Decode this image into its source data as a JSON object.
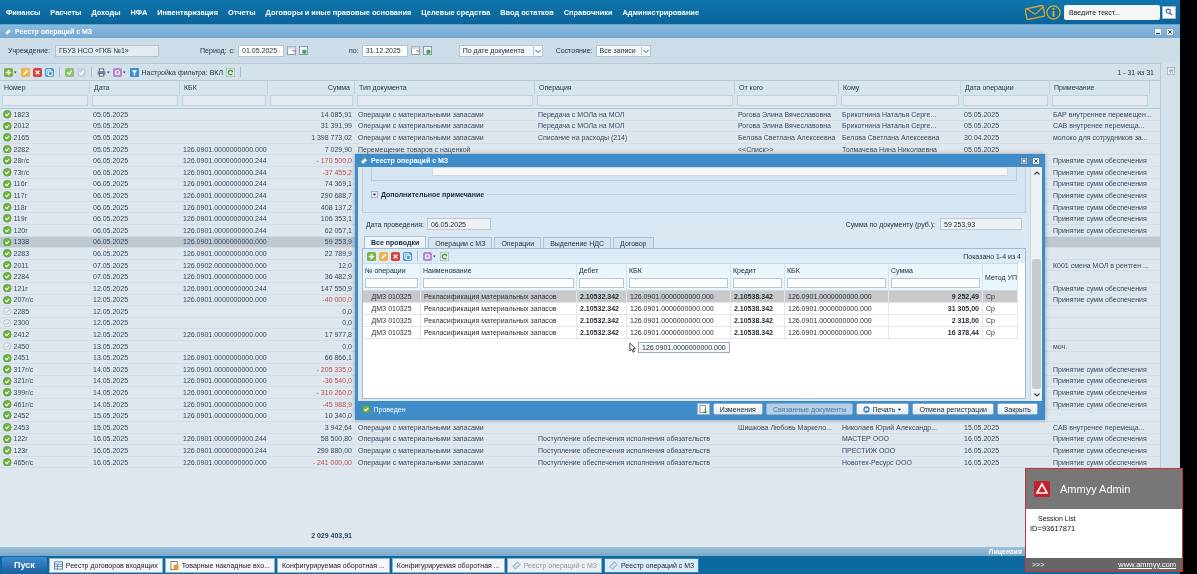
{
  "menu": [
    "Финансы",
    "Расчеты",
    "Доходы",
    "НФА",
    "Инвентаризация",
    "Отчеты",
    "Договоры и иные правовые основания",
    "Целевые средства",
    "Ввод остатков",
    "Справочники",
    "Администрирование"
  ],
  "search": {
    "placeholder": "Введите текст..."
  },
  "window": {
    "title": "Реестр операций с МЗ"
  },
  "filters": {
    "institution_label": "Учреждение:",
    "institution": "ГБУЗ НСО «ГКБ №1»",
    "period_label": "Период:",
    "from_label": "с:",
    "from": "01.05.2025",
    "to_label": "по:",
    "to": "31.12.2025",
    "date_mode": "По дате документа",
    "state_label": "Состояние:",
    "state": "Все записи"
  },
  "toolbar": {
    "filter_setting": "Настройка фильтра: ВКЛ",
    "paging": "1 - 31 из 31"
  },
  "columns": [
    "Номер",
    "Дата",
    "КБК",
    "Сумма",
    "Тип документа",
    "Операция",
    "От кого",
    "Кому",
    "Дата операции",
    "Примечание"
  ],
  "rows": [
    {
      "number": "1823",
      "date": "05.05.2025",
      "sum": "14 085,91",
      "doc_type": "Операции с материальными запасами",
      "operation": "Передача с МОЛа на МОЛ",
      "from": "Рогова Элина Вячеславовна",
      "to": "Брикотнина Наталья Серге...",
      "op_date": "05.05.2025",
      "note": "БАР внутреннее перемещен...",
      "posted": true,
      "negative": false,
      "selected": false
    },
    {
      "number": "2012",
      "date": "05.05.2025",
      "sum": "31 391,99",
      "doc_type": "Операции с материальными запасами",
      "operation": "Передача с МОЛа на МОЛ",
      "from": "Рогова Элина Вячеславовна",
      "to": "Брикотнина Наталья Серге...",
      "op_date": "05.05.2025",
      "note": "САВ внутренее перемеща...",
      "posted": true,
      "negative": false,
      "selected": false
    },
    {
      "number": "2165",
      "date": "05.05.2025",
      "sum": "1 398 773,02",
      "doc_type": "Операции с материальными запасами",
      "operation": "Списание на расходы (214)",
      "from": "Белова Светлана Алексеевна",
      "to": "Белова Светлана Алексеевна",
      "op_date": "30.04.2025",
      "note": "молоко для сотрудников за...",
      "posted": true,
      "negative": false,
      "selected": false
    },
    {
      "number": "2282",
      "date": "05.05.2025",
      "kbk": "126.0901.0000000000.000",
      "sum": "7 029,90",
      "doc_type": "Перемещение товаров с наценкой",
      "from": "<<Списк>>",
      "to": "Толмачева Нина Николаевна",
      "op_date": "05.05.2025",
      "posted": true,
      "negative": false,
      "selected": false
    },
    {
      "number": "28г/с",
      "date": "06.05.2025",
      "kbk": "126.0901.0000000000.244",
      "sum": "- 170 500,0",
      "note": "Принятие сумм обеспечения",
      "posted": true,
      "negative": true,
      "selected": false
    },
    {
      "number": "73г/с",
      "date": "06.05.2025",
      "kbk": "126.0901.0000000000.244",
      "sum": "-37 455,2",
      "note": "Принятие сумм обеспечения",
      "posted": true,
      "negative": true,
      "selected": false
    },
    {
      "number": "116г",
      "date": "06.05.2025",
      "kbk": "126.0901.0000000000.244",
      "sum": "74 369,1",
      "note": "Принятие сумм обеспечения",
      "posted": true,
      "negative": false,
      "selected": false
    },
    {
      "number": "117г",
      "date": "06.05.2025",
      "kbk": "126.0901.0000000000.244",
      "sum": "290 688,7",
      "note": "Принятие сумм обеспечения",
      "posted": true,
      "negative": false,
      "selected": false
    },
    {
      "number": "118г",
      "date": "06.05.2025",
      "kbk": "126.0901.0000000000.244",
      "sum": "408 137,2",
      "note": "Принятие сумм обеспечения",
      "posted": true,
      "negative": false,
      "selected": false
    },
    {
      "number": "119г",
      "date": "06.05.2025",
      "kbk": "126.0901.0000000000.244",
      "sum": "106 353,1",
      "note": "Принятие сумм обеспечения",
      "posted": true,
      "negative": false,
      "selected": false
    },
    {
      "number": "120г",
      "date": "06.05.2025",
      "kbk": "126.0901.0000000000.244",
      "sum": "62 057,1",
      "note": "Принятие сумм обеспечения",
      "posted": true,
      "negative": false,
      "selected": false
    },
    {
      "number": "1338",
      "date": "06.05.2025",
      "kbk": "126.0901.0000000000.000",
      "sum": "59 253,9",
      "posted": true,
      "negative": false,
      "selected": true
    },
    {
      "number": "2283",
      "date": "06.05.2025",
      "kbk": "126.0901.0000000000.000",
      "sum": "22 789,9",
      "posted": true,
      "negative": false,
      "selected": false
    },
    {
      "number": "2011",
      "date": "07.05.2025",
      "kbk": "126.0902.0000000000.000",
      "sum": "12,0",
      "note": "К001 смена МОЛ в рентген ...",
      "posted": true,
      "negative": false,
      "selected": false
    },
    {
      "number": "2284",
      "date": "07.05.2025",
      "kbk": "126.0901.0000000000.000",
      "sum": "36 482,9",
      "posted": true,
      "negative": false,
      "selected": false
    },
    {
      "number": "121г",
      "date": "12.05.2025",
      "kbk": "126.0901.0000000000.244",
      "sum": "147 550,9",
      "note": "Принятие сумм обеспечения",
      "posted": true,
      "negative": false,
      "selected": false
    },
    {
      "number": "207г/с",
      "date": "12.05.2025",
      "kbk": "126.0901.0000000000.000",
      "sum": "-40 000,0",
      "note": "Принятие сумм обеспечения",
      "posted": true,
      "negative": true,
      "selected": false
    },
    {
      "number": "2285",
      "date": "12.05.2025",
      "sum": "0,0",
      "posted": false,
      "negative": false,
      "selected": false
    },
    {
      "number": "2300",
      "date": "12.05.2025",
      "sum": "0,0",
      "posted": false,
      "negative": false,
      "selected": false
    },
    {
      "number": "2412",
      "date": "12.05.2025",
      "kbk": "126.0901.0000000000.000",
      "sum": "17 977,8",
      "posted": true,
      "negative": false,
      "selected": false
    },
    {
      "number": "2450",
      "date": "13.05.2025",
      "sum": "0,0",
      "note": "моч.",
      "posted": false,
      "negative": false,
      "selected": false
    },
    {
      "number": "2451",
      "date": "13.05.2025",
      "kbk": "126.0901.0000000000.000",
      "sum": "66 866,1",
      "posted": true,
      "negative": false,
      "selected": false
    },
    {
      "number": "317г/с",
      "date": "14.05.2025",
      "kbk": "126.0901.0000000000.000",
      "sum": "- 205 335,0",
      "note": "Принятие сумм обеспечения",
      "posted": true,
      "negative": true,
      "selected": false
    },
    {
      "number": "321г/с",
      "date": "14.05.2025",
      "kbk": "126.0901.0000000000.000",
      "sum": "-36 540,0",
      "note": "Принятие сумм обеспечения",
      "posted": true,
      "negative": true,
      "selected": false
    },
    {
      "number": "399г/с",
      "date": "14.05.2025",
      "kbk": "126.0901.0000000000.000",
      "sum": "- 310 260,0",
      "note": "Принятие сумм обеспечения",
      "posted": true,
      "negative": true,
      "selected": false
    },
    {
      "number": "461г/с",
      "date": "14.05.2025",
      "kbk": "126.0901.0000000000.000",
      "sum": "-45 988,9",
      "note": "Принятие сумм обеспечения",
      "posted": true,
      "negative": true,
      "selected": false
    },
    {
      "number": "2452",
      "date": "15.05.2025",
      "kbk": "126.0901.0000000000.000",
      "sum": "10 340,0",
      "posted": true,
      "negative": false,
      "selected": false
    },
    {
      "number": "2453",
      "date": "15.05.2025",
      "sum": "3 942,64",
      "doc_type": "Операции с материальными запасами",
      "from": "Шишкова Любовь Маркело...",
      "to": "Николаев Юрий Александр...",
      "op_date": "15.05.2025",
      "note": "САВ внутренее перемеща...",
      "posted": true,
      "negative": false,
      "selected": false
    },
    {
      "number": "122г",
      "date": "16.05.2025",
      "kbk": "126.0901.0000000000.244",
      "sum": "58 500,80",
      "doc_type": "Операции с материальными запасами",
      "operation": "Поступление обеспечения исполнения обязательств",
      "to": "МАСТЕР ООО",
      "op_date": "16.05.2025",
      "note": "Принятие сумм обеспечения",
      "posted": true,
      "negative": false,
      "selected": false
    },
    {
      "number": "123г",
      "date": "16.05.2025",
      "kbk": "126.0901.0000000000.244",
      "sum": "299 880,00",
      "doc_type": "Операции с материальными запасами",
      "operation": "Поступление обеспечения исполнения обязательств",
      "to": "ПРЕСТИЖ ООО",
      "op_date": "16.05.2025",
      "note": "Принятие сумм обеспечения",
      "posted": true,
      "negative": false,
      "selected": false
    },
    {
      "number": "465г/с",
      "date": "16.05.2025",
      "kbk": "126.0901.0000000000.000",
      "sum": "- 241 000,00",
      "doc_type": "Операции с материальными запасами",
      "operation": "Поступление обеспечения исполнения обязательств",
      "to": "Новотех-Ресурс ООО",
      "op_date": "16.05.2025",
      "note": "Принятие сумм обеспечения",
      "posted": true,
      "negative": true,
      "selected": false
    }
  ],
  "total": "2 029 403,91",
  "license": "Лицензия",
  "dialog": {
    "title": "Реестр операций с МЗ",
    "section": "Дополнительное примечание",
    "date_label": "Дата проведения:",
    "date": "06.05.2025",
    "sum_label": "Сумма по документу (руб.):",
    "sum": "59 253,93",
    "tabs": [
      {
        "label": "Все проводки",
        "selected": true
      },
      {
        "label": "Операции с МЗ",
        "selected": false
      },
      {
        "label": "Операции",
        "selected": false
      },
      {
        "label": "Выделение НДС",
        "selected": false
      },
      {
        "label": "Договор",
        "selected": false
      }
    ],
    "paging": "Показано 1-4 из 4",
    "columns": [
      "№ операции",
      "Наименование",
      "Дебет",
      "КБК",
      "Кредит",
      "КБК",
      "Сумма",
      "Метод УП"
    ],
    "rows": [
      {
        "cells": [
          "ДМЗ 010325",
          "Рекласификация материальных запасов",
          "2.10532.342",
          "126.0901.0000000000.000",
          "2.10538.342",
          "126.0901.0000000000.000",
          "9 252,49",
          "Ср"
        ],
        "selected": true
      },
      {
        "cells": [
          "ДМЗ 010325",
          "Рекласификация материальных запасов",
          "2.10532.342",
          "126.0901.0000000000.000",
          "2.10538.342",
          "126.0901.0000000000.000",
          "31 305,00",
          "Ср"
        ],
        "selected": false
      },
      {
        "cells": [
          "ДМЗ 010325",
          "Рекласификация материальных запасов",
          "2.10532.342",
          "126.0901.0000000000.000",
          "2.10538.342",
          "126.0901.0000000000.000",
          "2 318,00",
          "Ср"
        ],
        "selected": false
      },
      {
        "cells": [
          "ДМЗ 010325",
          "Рекласификация материальных запасов",
          "2.10532.342",
          "126.0901.0000000000.000",
          "2.10538.342",
          "126.0901.0000000000.000",
          "16 378,44",
          "Ср"
        ],
        "selected": false
      }
    ],
    "tooltip": "126.0901.0000000000.000",
    "status": "Проведен",
    "buttons": [
      {
        "label": "Изменения",
        "kind": "plain",
        "disabled": false
      },
      {
        "label": "Связанные документы",
        "kind": "plain",
        "disabled": true
      },
      {
        "label": "Печать",
        "kind": "menu",
        "disabled": false
      },
      {
        "label": "Отмена регистрации",
        "kind": "plain",
        "disabled": false
      },
      {
        "label": "Закрыть",
        "kind": "plain",
        "disabled": false
      }
    ]
  },
  "taskbar": {
    "start": "Пуск",
    "items": [
      {
        "label": "Реестр договоров входящих",
        "kind": "table",
        "disabled": false,
        "selected": false
      },
      {
        "label": "Товарные накладные вхо...",
        "kind": "invoice",
        "disabled": false,
        "selected": false
      },
      {
        "label": "Конфигурируемая оборотная ...",
        "kind": "plain",
        "disabled": false,
        "selected": false
      },
      {
        "label": "Конфигурируемая оборотная ...",
        "kind": "plain",
        "disabled": false,
        "selected": false
      },
      {
        "label": "Реестр операций с МЗ",
        "kind": "registry",
        "disabled": true,
        "selected": false
      },
      {
        "label": "Реестр операций с МЗ",
        "kind": "registry",
        "disabled": false,
        "selected": true
      }
    ]
  },
  "ammyy": {
    "title": "Ammyy Admin",
    "session": "Session List",
    "id": "ID=93617871",
    "more": ">>>",
    "link": "www.ammyy.com"
  }
}
